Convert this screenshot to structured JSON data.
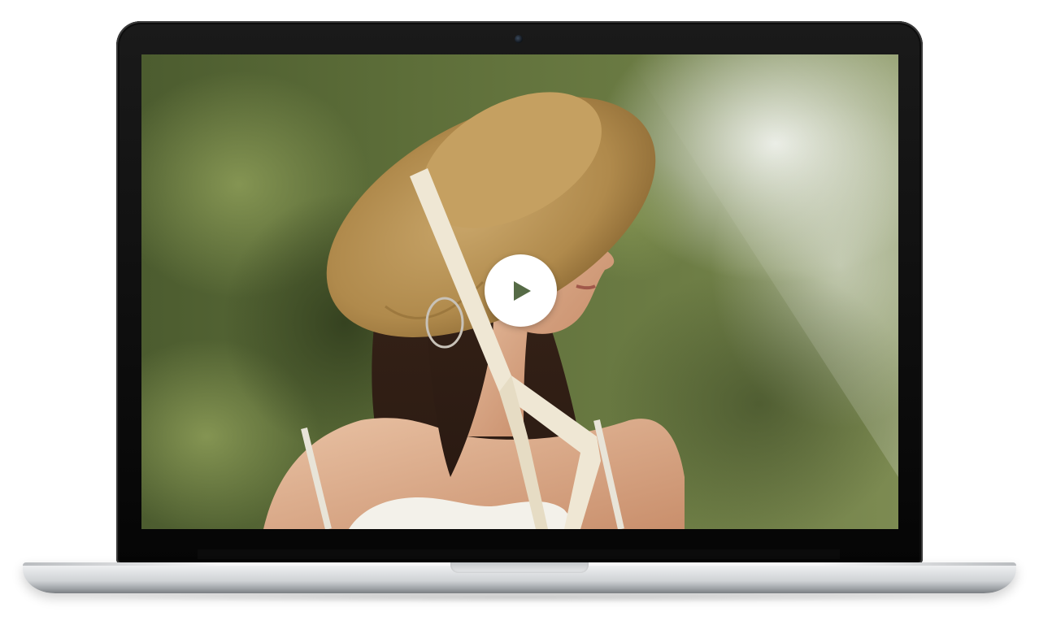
{
  "device": {
    "type": "laptop",
    "bezel_color": "#0a0a0a",
    "base_color": "#d9dbdd"
  },
  "video": {
    "state": "paused",
    "play_icon": "play-icon",
    "play_button_color": "#ffffff",
    "play_icon_color": "#566b46"
  },
  "photo": {
    "icon": "video-thumbnail"
  }
}
